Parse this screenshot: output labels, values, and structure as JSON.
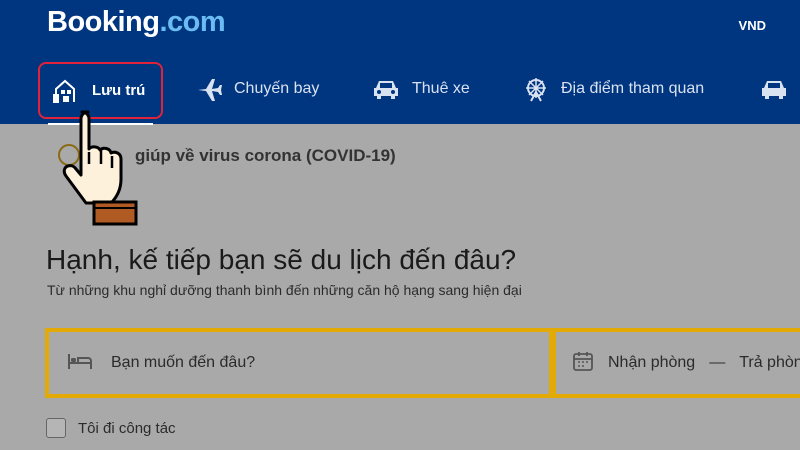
{
  "header": {
    "logo_main": "Booking",
    "logo_tld": ".com",
    "currency": "VND"
  },
  "nav": {
    "stays": "Lưu trú",
    "flights": "Chuyến bay",
    "car_rental": "Thuê xe",
    "attractions": "Địa điểm tham quan",
    "active": "stays"
  },
  "covid": {
    "text": "giúp về virus corona (COVID-19)"
  },
  "hero": {
    "title": "Hạnh, kế tiếp bạn sẽ du lịch đến đâu?",
    "subtitle": "Từ những khu nghỉ dưỡng thanh bình đến những căn hộ hạng sang hiện đại"
  },
  "search": {
    "destination_placeholder": "Bạn muốn đến đâu?",
    "checkin": "Nhận phòng",
    "dash": "—",
    "checkout": "Trả phòng"
  },
  "business": {
    "label": "Tôi đi công tác",
    "checked": false
  },
  "colors": {
    "header_bg": "#003580",
    "highlight_border": "#e0233a",
    "search_border": "#e3a905"
  },
  "icons": [
    "bed-building-icon",
    "airplane-icon",
    "car-icon",
    "ferris-wheel-icon",
    "taxi-icon",
    "bed-icon",
    "calendar-icon",
    "hand-pointer-icon"
  ]
}
